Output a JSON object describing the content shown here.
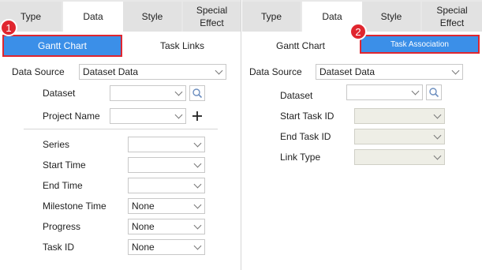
{
  "left_panel": {
    "tabs": [
      {
        "label": "Type"
      },
      {
        "label": "Data"
      },
      {
        "label": "Style"
      },
      {
        "label": "Special Effect"
      }
    ],
    "subtabs": [
      {
        "label": "Gantt Chart",
        "active": true
      },
      {
        "label": "Task Links",
        "active": false
      }
    ],
    "badge": "1",
    "data_source": {
      "label": "Data Source",
      "value": "Dataset Data"
    },
    "dataset": {
      "label": "Dataset",
      "value": ""
    },
    "project_name": {
      "label": "Project Name",
      "value": ""
    },
    "series": {
      "label": "Series",
      "value": ""
    },
    "start_time": {
      "label": "Start Time",
      "value": ""
    },
    "end_time": {
      "label": "End Time",
      "value": ""
    },
    "milestone_time": {
      "label": "Milestone Time",
      "value": "None"
    },
    "progress": {
      "label": "Progress",
      "value": "None"
    },
    "task_id": {
      "label": "Task ID",
      "value": "None"
    }
  },
  "right_panel": {
    "tabs": [
      {
        "label": "Type"
      },
      {
        "label": "Data"
      },
      {
        "label": "Style"
      },
      {
        "label": "Special Effect"
      }
    ],
    "subtabs": [
      {
        "label": "Gantt Chart",
        "active": false
      },
      {
        "label": "Task Association",
        "active": true
      }
    ],
    "badge": "2",
    "data_source": {
      "label": "Data Source",
      "value": "Dataset Data"
    },
    "dataset": {
      "label": "Dataset",
      "value": ""
    },
    "start_task_id": {
      "label": "Start Task ID",
      "value": ""
    },
    "end_task_id": {
      "label": "End Task ID",
      "value": ""
    },
    "link_type": {
      "label": "Link Type",
      "value": ""
    }
  },
  "colors": {
    "accent": "#3b8fe8",
    "highlight": "#e0262f"
  }
}
